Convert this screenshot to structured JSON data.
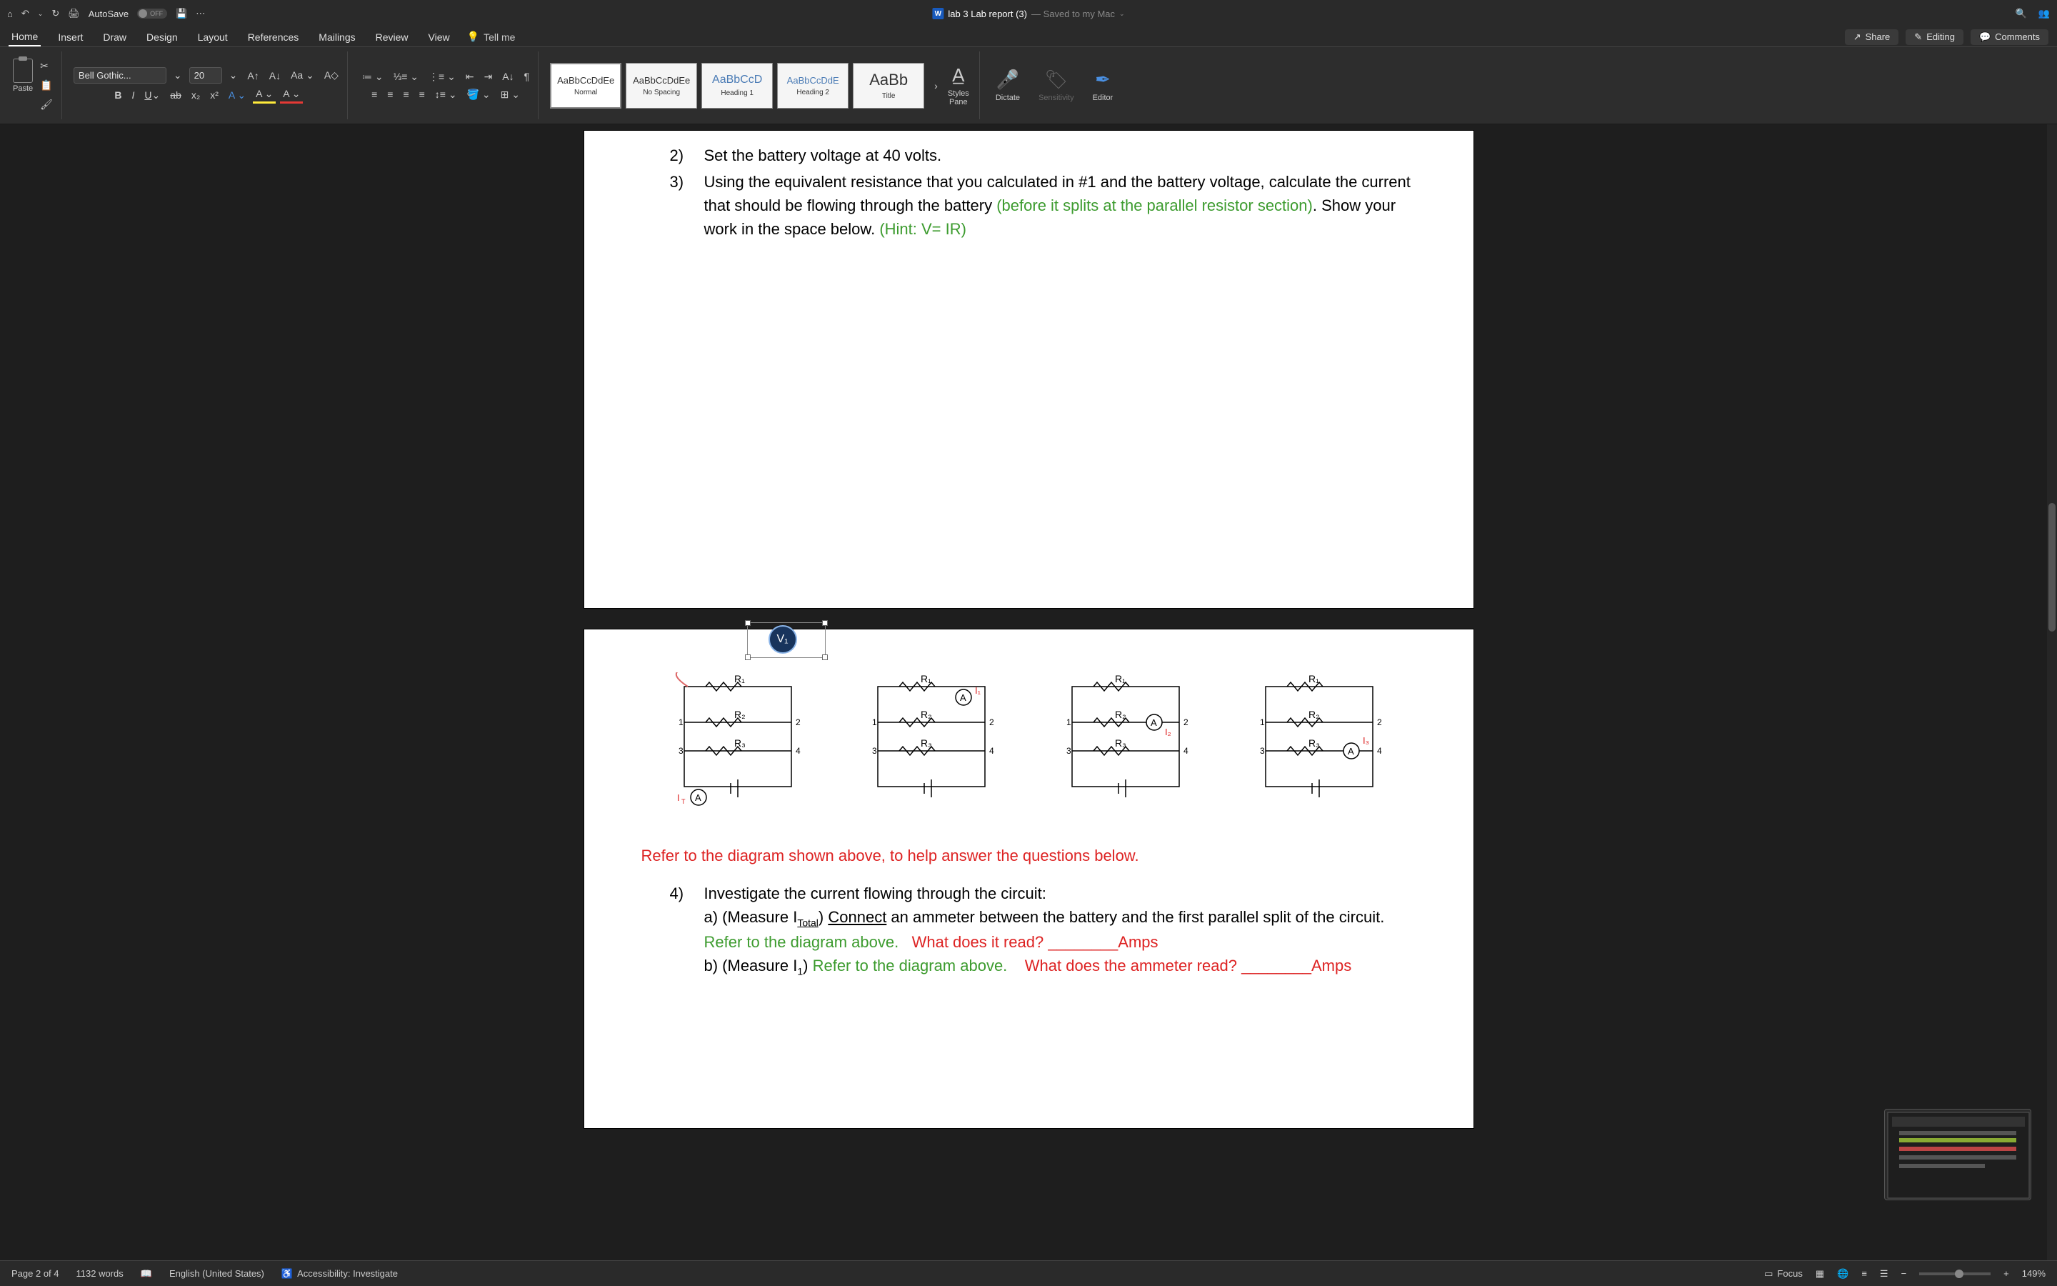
{
  "titlebar": {
    "autosave_label": "AutoSave",
    "autosave_state": "OFF",
    "doc_title": "lab 3 Lab report (3)",
    "saved_status": "— Saved to my Mac"
  },
  "tabs": {
    "home": "Home",
    "insert": "Insert",
    "draw": "Draw",
    "design": "Design",
    "layout": "Layout",
    "references": "References",
    "mailings": "Mailings",
    "review": "Review",
    "view": "View",
    "tellme": "Tell me",
    "share": "Share",
    "editing": "Editing",
    "comments": "Comments"
  },
  "ribbon": {
    "paste": "Paste",
    "font_name": "Bell Gothic...",
    "font_size": "20",
    "styles": {
      "normal": {
        "sample": "AaBbCcDdEe",
        "name": "Normal"
      },
      "nospacing": {
        "sample": "AaBbCcDdEe",
        "name": "No Spacing"
      },
      "heading1": {
        "sample": "AaBbCcD",
        "name": "Heading 1"
      },
      "heading2": {
        "sample": "AaBbCcDdE",
        "name": "Heading 2"
      },
      "title": {
        "sample": "AaBb",
        "name": "Title"
      }
    },
    "styles_pane": "Styles\nPane",
    "dictate": "Dictate",
    "sensitivity": "Sensitivity",
    "editor": "Editor"
  },
  "doc": {
    "item2_num": "2)",
    "item2_text": "Set the battery voltage at 40 volts.",
    "item3_num": "3)",
    "item3_text_a": "Using the equivalent resistance that you calculated in #1 and the battery voltage, calculate the current that should be flowing through the battery ",
    "item3_green1": "(before it splits at the parallel resistor section)",
    "item3_text_b": ". Show your work in the space below. ",
    "item3_green2": "(Hint: V= IR)",
    "red_instr": "Refer to the diagram shown above, to help answer the questions below.",
    "item4_num": "4)",
    "item4_text": "Investigate the current flowing through the circuit:",
    "item4a_pre": "a) (Measure I",
    "item4a_sub": "Total",
    "item4a_mid1": ")  ",
    "item4a_connect": "Connect",
    "item4a_mid2": " an ammeter between the battery and the first parallel split of the circuit.",
    "item4a_green": "Refer to the diagram above.",
    "item4a_red": "What does it read?",
    "item4a_blank": " ________",
    "item4a_amps": "Amps",
    "item4b_pre": "b) (Measure I",
    "item4b_sub": "1",
    "item4b_mid": ") ",
    "item4b_green": "Refer to the diagram above.",
    "item4b_red": "What does the ammeter read?",
    "item4b_blank": " ________",
    "item4b_amps": "Amps",
    "voltmeter_label": "V₁"
  },
  "status": {
    "page": "Page 2 of 4",
    "words": "1132 words",
    "lang": "English (United States)",
    "accessibility": "Accessibility: Investigate",
    "focus": "Focus",
    "zoom": "149%"
  },
  "icons": {
    "home": "⌂",
    "undo": "↶",
    "redo": "↻",
    "print": "🖨",
    "save": "💾",
    "more": "⋯",
    "search": "🔍",
    "user": "👤",
    "chevron": "⌄"
  }
}
